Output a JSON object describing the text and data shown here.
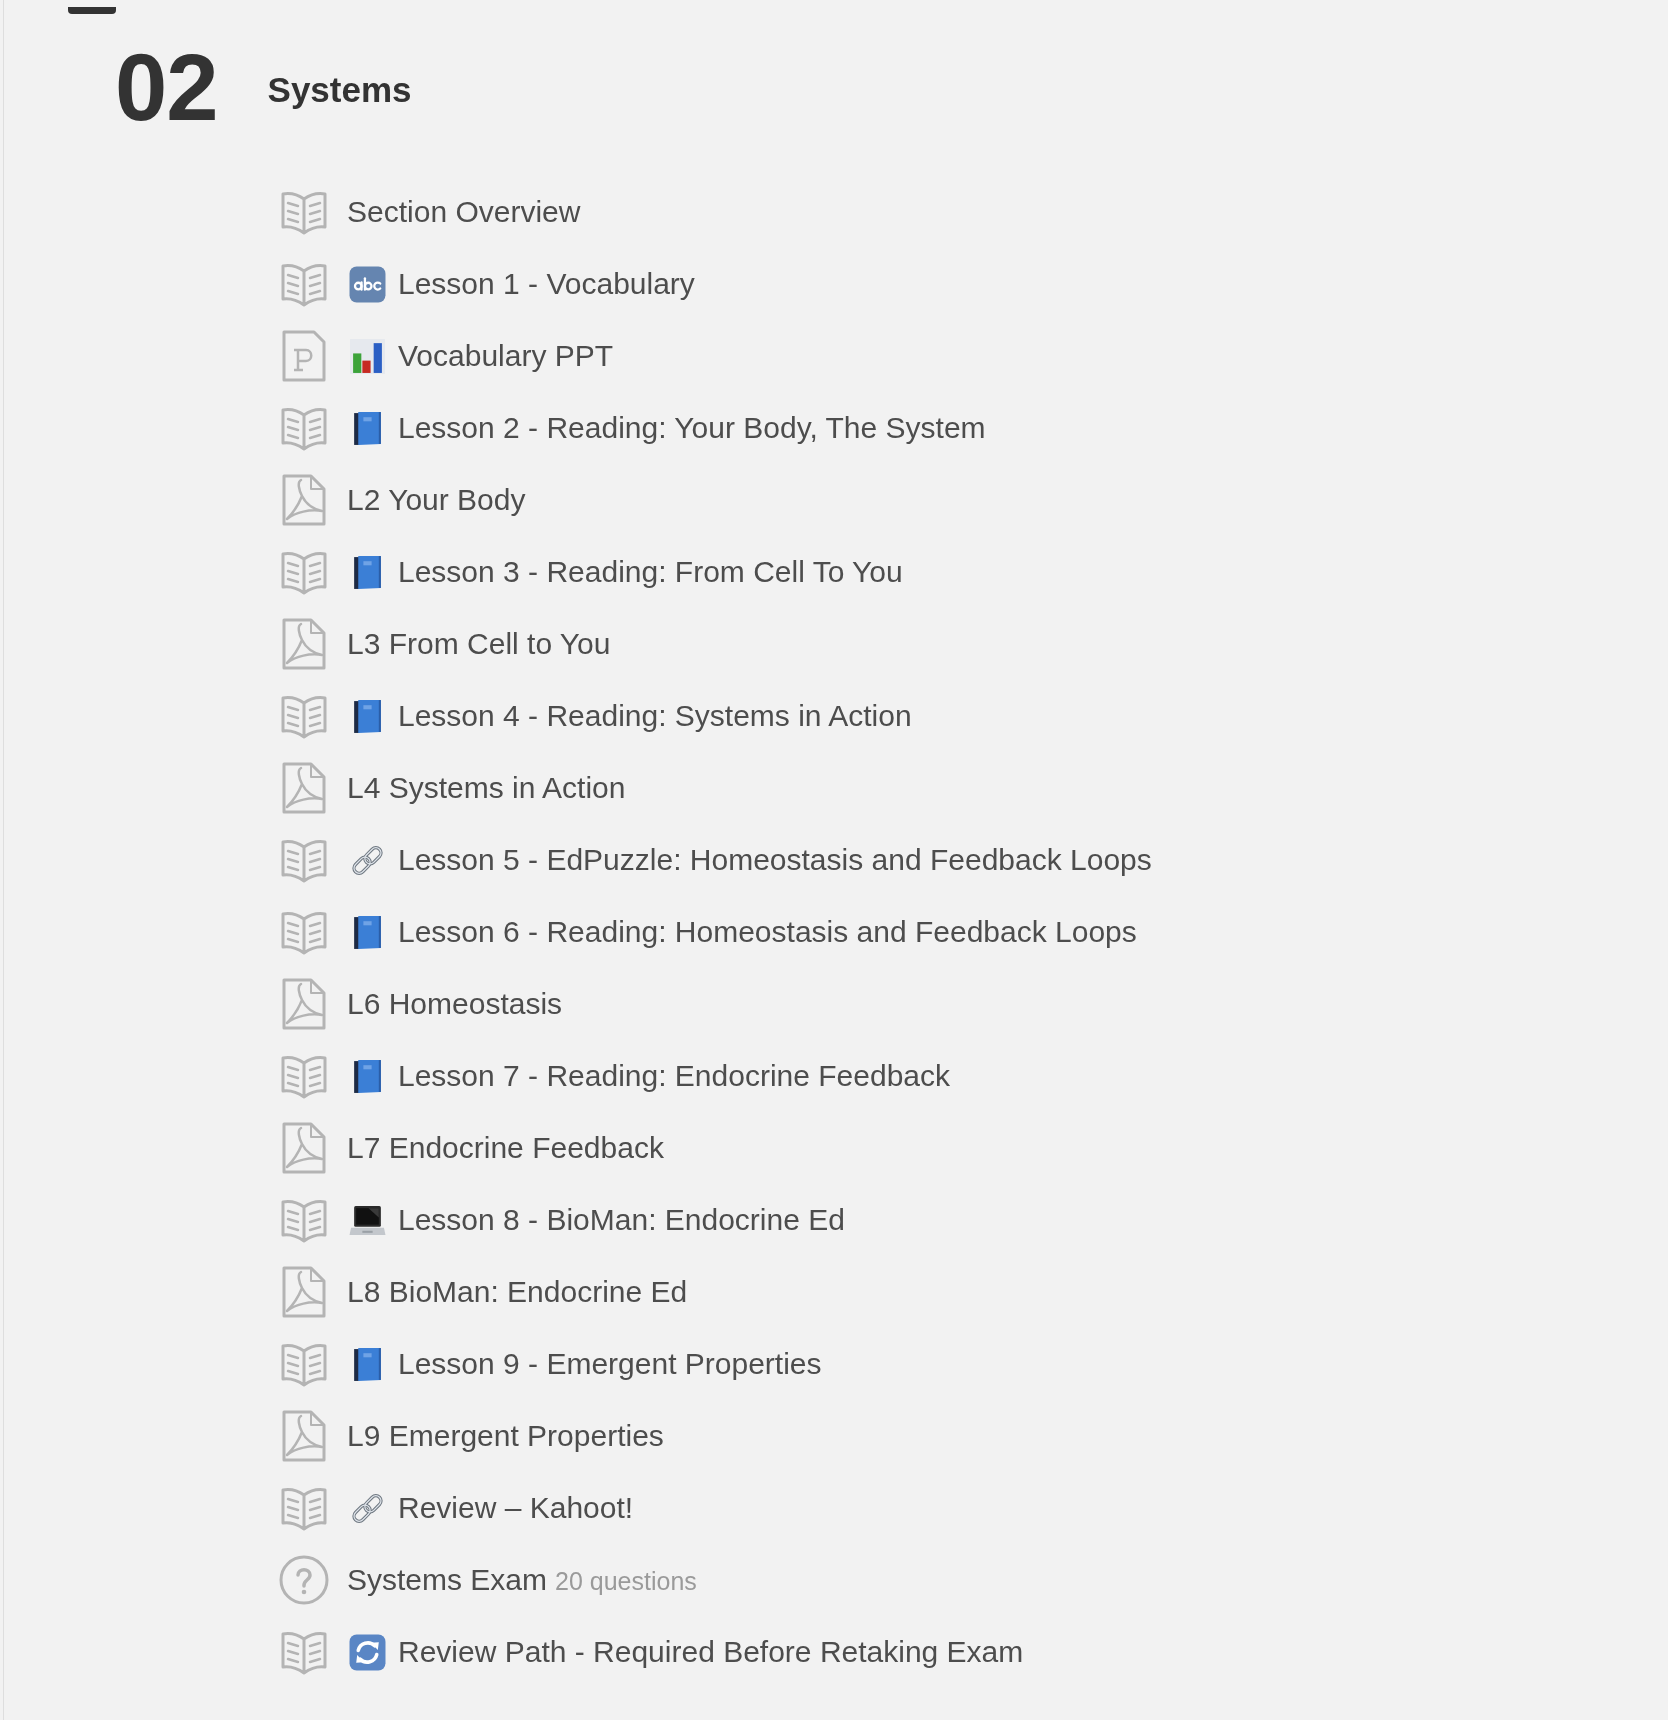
{
  "section": {
    "number": "02",
    "title": "Systems"
  },
  "items": [
    {
      "kind": "page",
      "title": "Section Overview"
    },
    {
      "kind": "page",
      "emoji": {
        "kind": "abc"
      },
      "title": "Lesson 1 - Vocabulary"
    },
    {
      "kind": "slides",
      "emoji": {
        "kind": "chart"
      },
      "title": "Vocabulary PPT"
    },
    {
      "kind": "page",
      "emoji": {
        "kind": "book"
      },
      "title": "Lesson 2 - Reading: Your Body, The System"
    },
    {
      "kind": "pdf",
      "title": "L2 Your Body"
    },
    {
      "kind": "page",
      "emoji": {
        "kind": "book"
      },
      "title": "Lesson 3 - Reading: From Cell To You"
    },
    {
      "kind": "pdf",
      "title": "L3 From Cell to You"
    },
    {
      "kind": "page",
      "emoji": {
        "kind": "book"
      },
      "title": "Lesson 4 - Reading: Systems in Action"
    },
    {
      "kind": "pdf",
      "title": "L4 Systems in Action"
    },
    {
      "kind": "page",
      "emoji": {
        "kind": "link"
      },
      "title": "Lesson 5 - EdPuzzle: Homeostasis and Feedback Loops"
    },
    {
      "kind": "page",
      "emoji": {
        "kind": "book"
      },
      "title": "Lesson 6 - Reading: Homeostasis and Feedback Loops"
    },
    {
      "kind": "pdf",
      "title": "L6 Homeostasis"
    },
    {
      "kind": "page",
      "emoji": {
        "kind": "book"
      },
      "title": "Lesson 7 - Reading: Endocrine Feedback"
    },
    {
      "kind": "pdf",
      "title": "L7 Endocrine Feedback"
    },
    {
      "kind": "page",
      "emoji": {
        "kind": "laptop"
      },
      "title": "Lesson 8 - BioMan: Endocrine Ed"
    },
    {
      "kind": "pdf",
      "title": "L8 BioMan: Endocrine Ed"
    },
    {
      "kind": "page",
      "emoji": {
        "kind": "book"
      },
      "title": "Lesson 9 - Emergent Properties"
    },
    {
      "kind": "pdf",
      "title": "L9 Emergent Properties"
    },
    {
      "kind": "page",
      "emoji": {
        "kind": "link"
      },
      "title": "Review – Kahoot!"
    },
    {
      "kind": "quiz",
      "title": "Systems Exam",
      "meta": "20 questions"
    },
    {
      "kind": "page",
      "emoji": {
        "kind": "repeat"
      },
      "title": "Review Path - Required Before Retaking Exam"
    }
  ]
}
